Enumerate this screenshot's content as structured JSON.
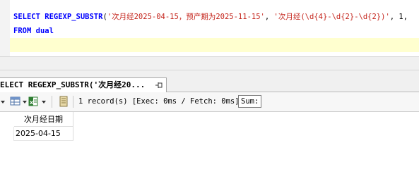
{
  "editor": {
    "line1": {
      "kw_select": "SELECT",
      "fn": "REGEXP_SUBSTR",
      "open": "(",
      "str1": "'次月经2025-04-15，预产期为2025-11-15'",
      "comma1": ", ",
      "str2": "'次月经(\\d{4}-\\d{2}-\\d{2})'",
      "tail": ", 1,"
    },
    "line2": {
      "kw_from": "FROM",
      "table": "dual"
    }
  },
  "result_tab": {
    "label": "ELECT REGEXP_SUBSTR('次月经20..."
  },
  "toolbar": {
    "status": "1 record(s) [Exec: 0ms / Fetch: 0ms]",
    "sum_label": "Sum:"
  },
  "grid": {
    "columns": [
      "次月经日期"
    ],
    "rows": [
      [
        "2025-04-15"
      ]
    ]
  },
  "colors": {
    "keyword": "#0000ff",
    "string": "#c4241b",
    "current_line": "#ffffcf"
  }
}
